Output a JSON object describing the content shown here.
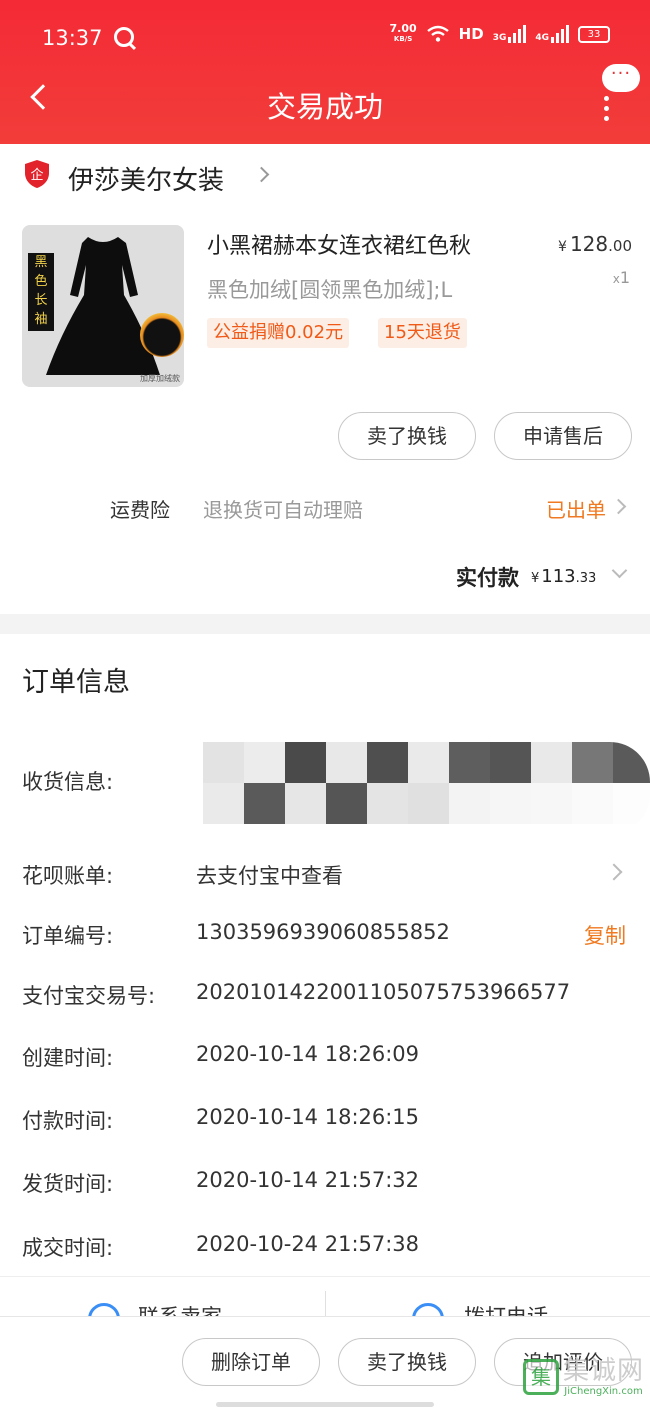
{
  "status_bar": {
    "time": "13:37",
    "net_speed": "7.00",
    "net_unit": "KB/S",
    "hd": "HD",
    "sig1": "3G",
    "sig2": "4G",
    "battery": "33"
  },
  "header": {
    "title": "交易成功",
    "more": "···",
    "accent_color": "#f42a36"
  },
  "shop": {
    "name": "伊莎美尔女装",
    "badge": "企"
  },
  "product": {
    "title": "小黑裙赫本女连衣裙红色秋",
    "price_symbol": "¥",
    "price_int": "128",
    "price_dec": ".00",
    "sku": "黑色加绒[圆领黑色加绒];L",
    "qty_x": "x",
    "qty": "1",
    "tag1": "公益捐赠0.02元",
    "tag2": "15天退货",
    "image_label": [
      "黑",
      "色",
      "长",
      "袖"
    ],
    "image_caption": "加厚加绒款"
  },
  "actions": {
    "resell": "卖了换钱",
    "after_sale": "申请售后"
  },
  "insurance": {
    "label": "运费险",
    "desc": "退换货可自动理赔",
    "status": "已出单"
  },
  "payment": {
    "label": "实付款",
    "symbol": "¥",
    "int": "113",
    "dec": ".33"
  },
  "order_info": {
    "title": "订单信息",
    "rows": [
      {
        "label": "收货信息:",
        "value": ""
      },
      {
        "label": "花呗账单:",
        "value": "去支付宝中查看"
      },
      {
        "label": "订单编号:",
        "value": "1303596939060855852"
      },
      {
        "label": "支付宝交易号:",
        "value": "2020101422001105075753966577"
      },
      {
        "label": "创建时间:",
        "value": "2020-10-14 18:26:09"
      },
      {
        "label": "付款时间:",
        "value": "2020-10-14 18:26:15"
      },
      {
        "label": "发货时间:",
        "value": "2020-10-14 21:57:32"
      },
      {
        "label": "成交时间:",
        "value": "2020-10-24 21:57:38"
      }
    ],
    "copy": "复制"
  },
  "contact": {
    "seller": "联系卖家",
    "call": "拨打电话"
  },
  "bottom_bar": {
    "delete": "删除订单",
    "resell": "卖了换钱",
    "review": "追加评价"
  },
  "watermark": {
    "cn": "集诚网",
    "en": "JiChengXin.com",
    "box": "集"
  }
}
